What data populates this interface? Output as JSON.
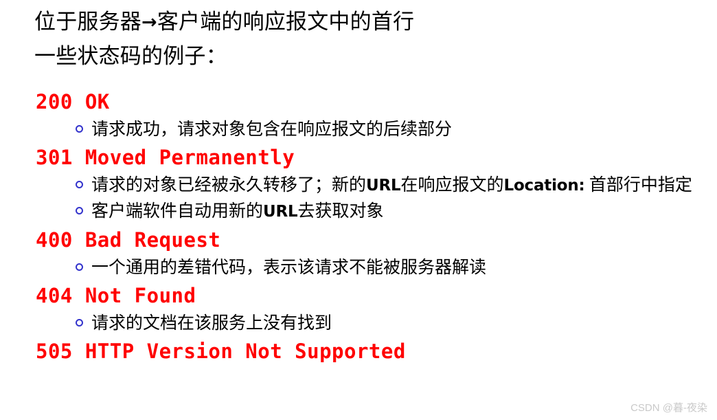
{
  "slide": {
    "background_color": "#ffffff",
    "heading_color": "#ff0000",
    "bullet_color": "#3333cc",
    "body_color": "#000000",
    "title_lines": [
      {
        "before_arrow": "位于服务器",
        "arrow": "→",
        "after_arrow": "客户端的响应报文中的首行"
      },
      {
        "before_arrow": "一些状态码的例子：",
        "arrow": "",
        "after_arrow": ""
      }
    ],
    "codes": [
      {
        "heading": "200 OK",
        "bullets": [
          {
            "parts": [
              {
                "text": "请求成功，请求对象包含在响应报文的后续部分",
                "emph": false
              }
            ]
          }
        ]
      },
      {
        "heading": "301 Moved Permanently",
        "bullets": [
          {
            "parts": [
              {
                "text": "请求的对象已经被永久转移了；新的",
                "emph": false
              },
              {
                "text": "URL",
                "emph": true
              },
              {
                "text": "在响应报文的",
                "emph": false
              },
              {
                "text": "Location:",
                "emph": true
              },
              {
                "text": " 首部行中指定",
                "emph": false
              }
            ]
          },
          {
            "parts": [
              {
                "text": "客户端软件自动用新的",
                "emph": false
              },
              {
                "text": "URL",
                "emph": true
              },
              {
                "text": "去获取对象",
                "emph": false
              }
            ]
          }
        ]
      },
      {
        "heading": "400 Bad Request",
        "bullets": [
          {
            "parts": [
              {
                "text": "一个通用的差错代码，表示该请求不能被服务器解读",
                "emph": false
              }
            ]
          }
        ]
      },
      {
        "heading": "404 Not Found",
        "bullets": [
          {
            "parts": [
              {
                "text": "请求的文档在该服务上没有找到",
                "emph": false
              }
            ]
          }
        ]
      },
      {
        "heading": "505 HTTP Version Not Supported",
        "bullets": []
      }
    ],
    "watermark": "CSDN @暮-夜染"
  }
}
